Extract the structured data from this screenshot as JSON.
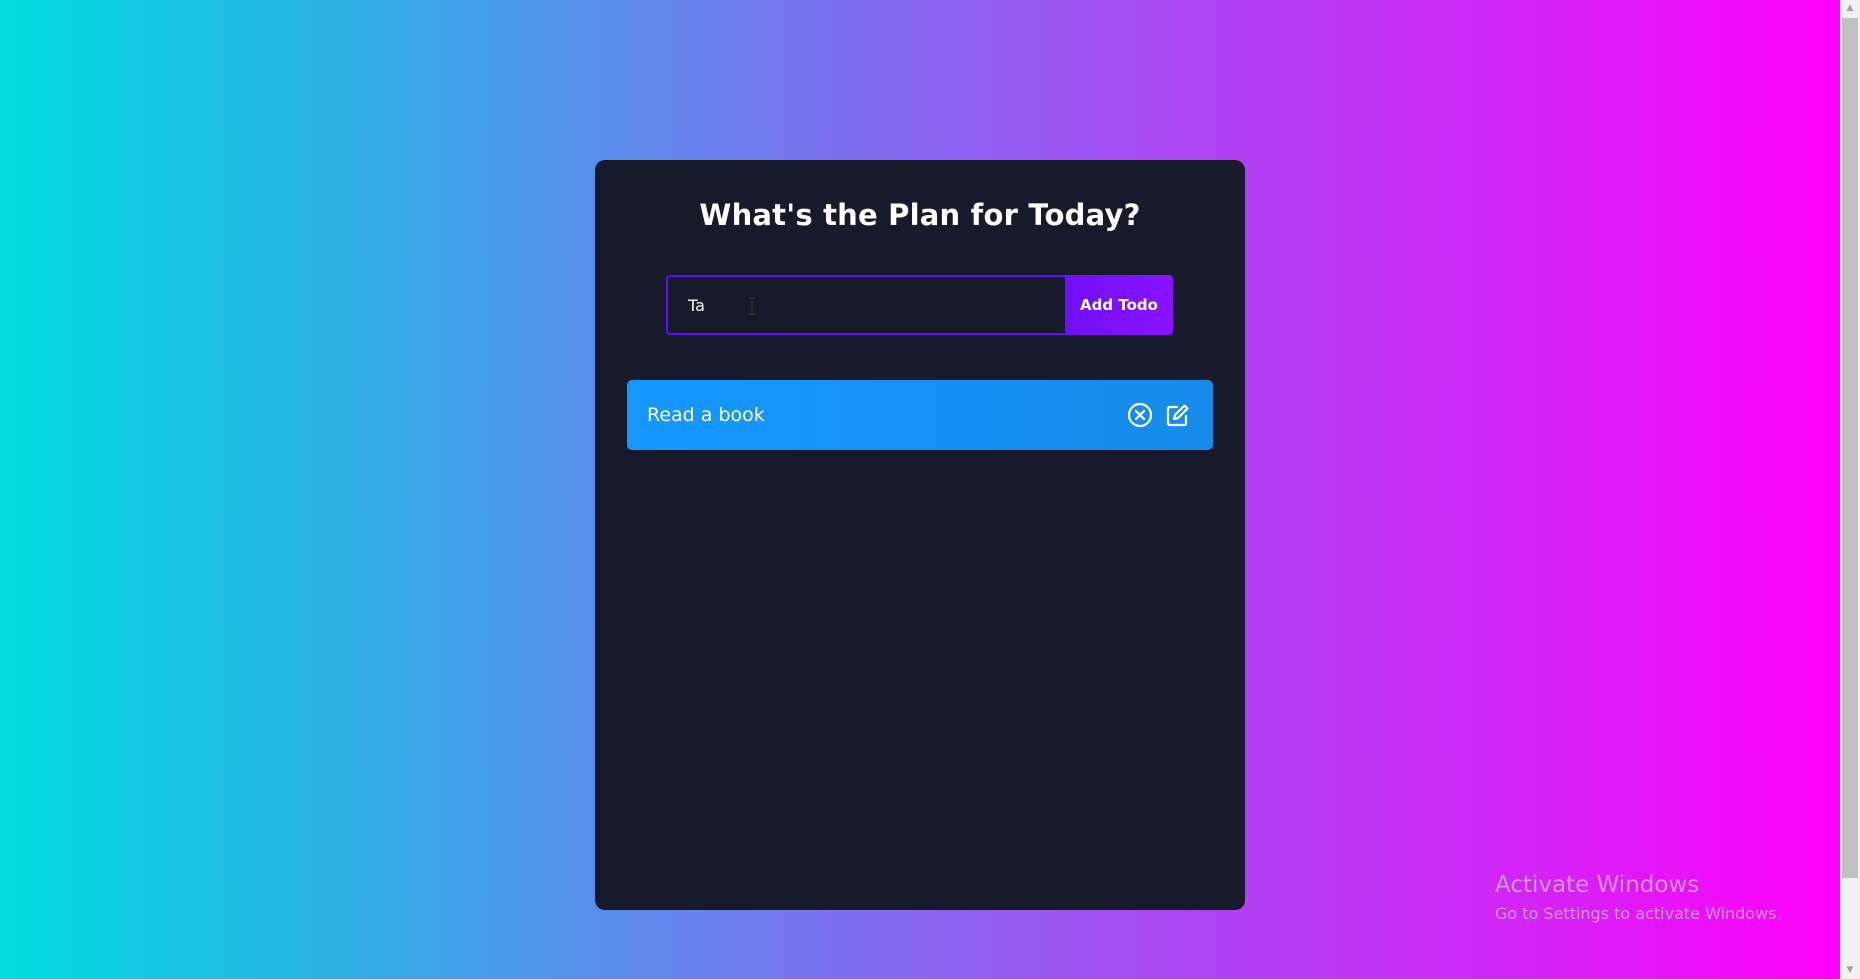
{
  "app": {
    "title": "What's the Plan for Today?"
  },
  "form": {
    "input_value": "Ta",
    "add_label": "Add Todo"
  },
  "todos": [
    {
      "text": "Read a book"
    }
  ],
  "icons": {
    "delete": "close-circle-icon",
    "edit": "edit-icon"
  },
  "watermark": {
    "title": "Activate Windows",
    "subtitle": "Go to Settings to activate Windows."
  },
  "colors": {
    "card_bg": "#161a2b",
    "accent_purple": "#5d0cff",
    "todo_blue": "#1598ff"
  }
}
